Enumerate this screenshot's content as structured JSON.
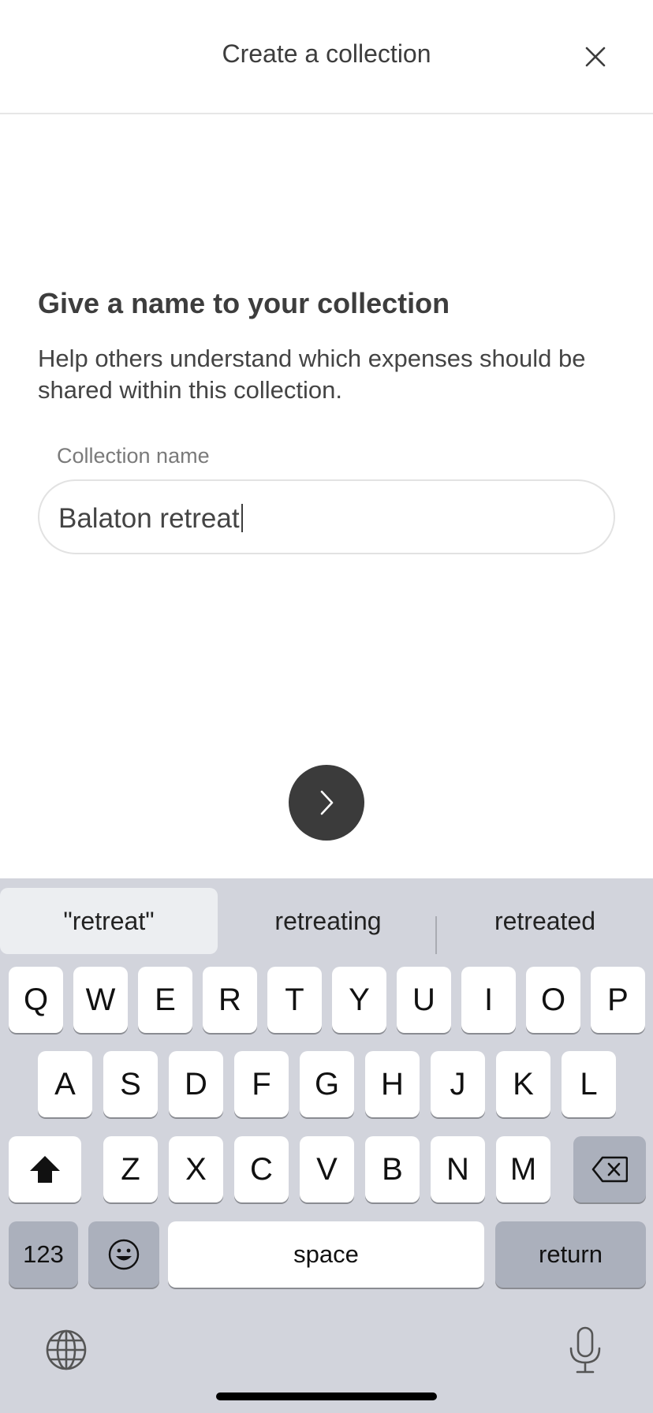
{
  "header": {
    "title": "Create a collection",
    "close_icon": "close-icon"
  },
  "prompt": {
    "title": "Give a name to your collection",
    "description": "Help others understand which expenses should be shared within this collection."
  },
  "field": {
    "label": "Collection name",
    "value": "Balaton retreat"
  },
  "next_button": {
    "icon": "chevron-right-icon"
  },
  "keyboard": {
    "suggestions": [
      "\"retreat\"",
      "retreating",
      "retreated"
    ],
    "row1": [
      "Q",
      "W",
      "E",
      "R",
      "T",
      "Y",
      "U",
      "I",
      "O",
      "P"
    ],
    "row2": [
      "A",
      "S",
      "D",
      "F",
      "G",
      "H",
      "J",
      "K",
      "L"
    ],
    "row3": [
      "Z",
      "X",
      "C",
      "V",
      "B",
      "N",
      "M"
    ],
    "numbers_key": "123",
    "space_key": "space",
    "return_key": "return",
    "shift_icon": "shift-icon",
    "delete_icon": "backspace-icon",
    "emoji_icon": "emoji-icon",
    "globe_icon": "globe-icon",
    "mic_icon": "microphone-icon"
  },
  "colors": {
    "keyboard_bg": "#d2d4dc",
    "key_bg": "#ffffff",
    "special_key_bg": "#abb0bc",
    "next_button_bg": "#3b3b3b"
  }
}
